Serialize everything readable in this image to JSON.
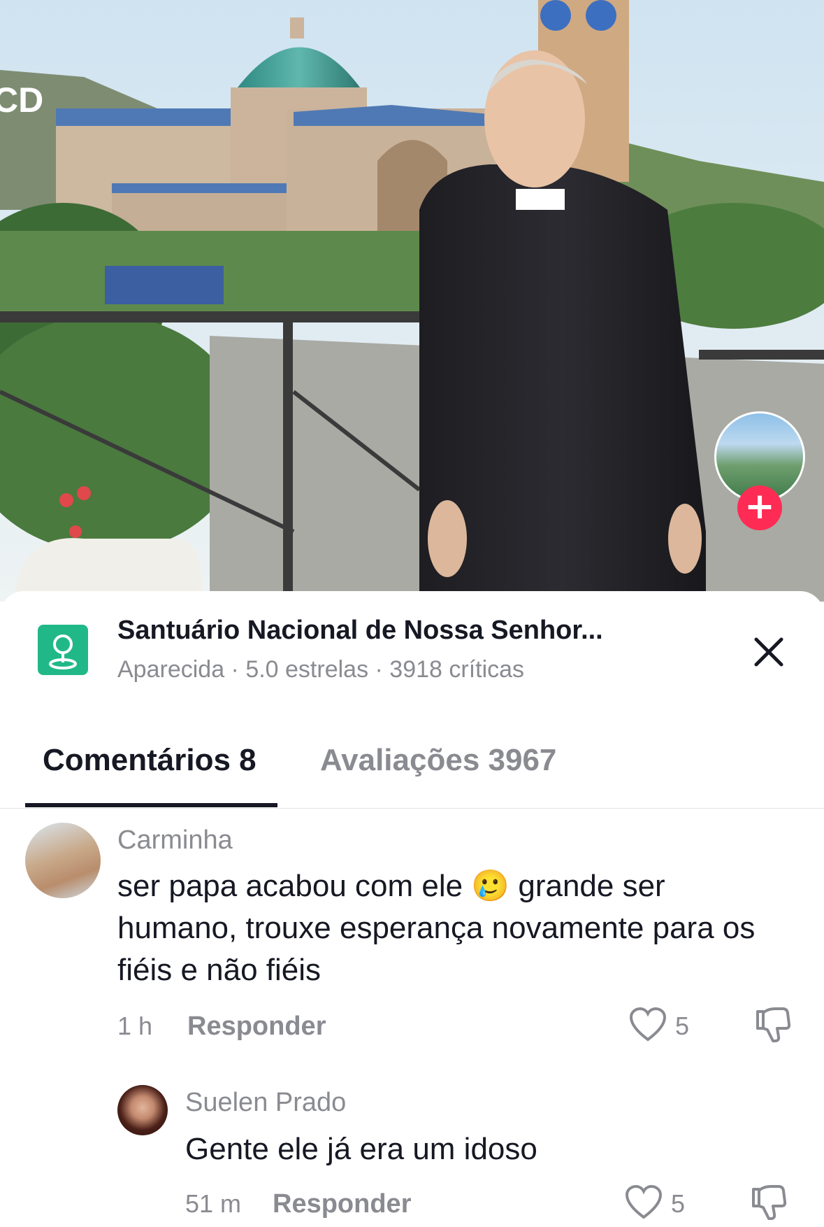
{
  "location": {
    "icon": "map-pin-icon",
    "title": "Santuário Nacional de Nossa Senhor...",
    "subtitle": "Aparecida · 5.0 estrelas · 3918 críticas"
  },
  "tabs": [
    {
      "label": "Comentários 8",
      "active": true
    },
    {
      "label": "Avaliações 3967",
      "active": false
    }
  ],
  "comments": [
    {
      "username": "Carminha",
      "text_part1": "ser papa acabou com ele ",
      "emoji": "🥲",
      "text_part2": " grande ser humano, trouxe esperança novamente para os fiéis e não fiéis",
      "time": "1 h",
      "reply_label": "Responder",
      "likes": "5"
    },
    {
      "username": "Suelen Prado",
      "text": "Gente ele já era um idoso",
      "time": "51 m",
      "reply_label": "Responder",
      "likes": "5"
    }
  ],
  "colors": {
    "primary_text": "#161823",
    "secondary_text": "#8a8b91",
    "location_icon_bg": "#21b887",
    "follow_plus": "#fe2c55"
  }
}
